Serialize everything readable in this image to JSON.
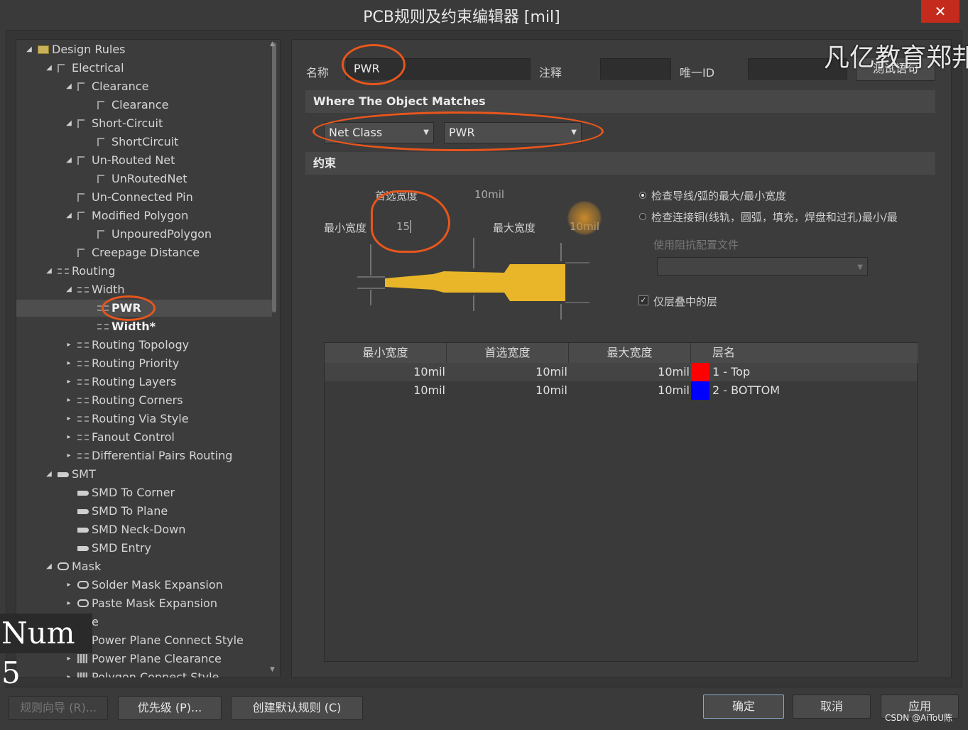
{
  "window": {
    "title": "PCB规则及约束编辑器 [mil]",
    "close_glyph": "✕"
  },
  "tree": {
    "items": [
      {
        "label": "Design Rules",
        "level": 0,
        "expand": "open",
        "icon": "folder-icon"
      },
      {
        "label": "Electrical",
        "level": 1,
        "expand": "open",
        "icon": "rule-icon"
      },
      {
        "label": "Clearance",
        "level": 2,
        "expand": "open",
        "icon": "rule-icon"
      },
      {
        "label": "Clearance",
        "level": 3,
        "expand": "none",
        "icon": "rule-icon"
      },
      {
        "label": "Short-Circuit",
        "level": 2,
        "expand": "open",
        "icon": "rule-icon"
      },
      {
        "label": "ShortCircuit",
        "level": 3,
        "expand": "none",
        "icon": "rule-icon"
      },
      {
        "label": "Un-Routed Net",
        "level": 2,
        "expand": "open",
        "icon": "rule-icon"
      },
      {
        "label": "UnRoutedNet",
        "level": 3,
        "expand": "none",
        "icon": "rule-icon"
      },
      {
        "label": "Un-Connected Pin",
        "level": 2,
        "expand": "none",
        "icon": "rule-icon"
      },
      {
        "label": "Modified Polygon",
        "level": 2,
        "expand": "open",
        "icon": "rule-icon"
      },
      {
        "label": "UnpouredPolygon",
        "level": 3,
        "expand": "none",
        "icon": "rule-icon"
      },
      {
        "label": "Creepage Distance",
        "level": 2,
        "expand": "none",
        "icon": "rule-icon"
      },
      {
        "label": "Routing",
        "level": 1,
        "expand": "open",
        "icon": "routing-icon"
      },
      {
        "label": "Width",
        "level": 2,
        "expand": "open",
        "icon": "routing-icon"
      },
      {
        "label": "PWR",
        "level": 3,
        "expand": "none",
        "icon": "routing-icon",
        "bold": true,
        "selected": true
      },
      {
        "label": "Width*",
        "level": 3,
        "expand": "none",
        "icon": "routing-icon",
        "bold": true
      },
      {
        "label": "Routing Topology",
        "level": 2,
        "expand": "closed",
        "icon": "routing-icon"
      },
      {
        "label": "Routing Priority",
        "level": 2,
        "expand": "closed",
        "icon": "routing-icon"
      },
      {
        "label": "Routing Layers",
        "level": 2,
        "expand": "closed",
        "icon": "routing-icon"
      },
      {
        "label": "Routing Corners",
        "level": 2,
        "expand": "closed",
        "icon": "routing-icon"
      },
      {
        "label": "Routing Via Style",
        "level": 2,
        "expand": "closed",
        "icon": "routing-icon"
      },
      {
        "label": "Fanout Control",
        "level": 2,
        "expand": "closed",
        "icon": "routing-icon"
      },
      {
        "label": "Differential Pairs Routing",
        "level": 2,
        "expand": "closed",
        "icon": "routing-icon"
      },
      {
        "label": "SMT",
        "level": 1,
        "expand": "open",
        "icon": "smt-icon"
      },
      {
        "label": "SMD To Corner",
        "level": 2,
        "expand": "none",
        "icon": "smt-icon"
      },
      {
        "label": "SMD To Plane",
        "level": 2,
        "expand": "none",
        "icon": "smt-icon"
      },
      {
        "label": "SMD Neck-Down",
        "level": 2,
        "expand": "none",
        "icon": "smt-icon"
      },
      {
        "label": "SMD Entry",
        "level": 2,
        "expand": "none",
        "icon": "smt-icon"
      },
      {
        "label": "Mask",
        "level": 1,
        "expand": "open",
        "icon": "mask-icon"
      },
      {
        "label": "Solder Mask Expansion",
        "level": 2,
        "expand": "closed",
        "icon": "mask-icon"
      },
      {
        "label": "Paste Mask Expansion",
        "level": 2,
        "expand": "closed",
        "icon": "mask-icon"
      },
      {
        "label": "e",
        "level": 2,
        "expand": "none",
        "icon": "none"
      },
      {
        "label": "Power Plane Connect Style",
        "level": 2,
        "expand": "none",
        "icon": "plane-icon"
      },
      {
        "label": "Power Plane Clearance",
        "level": 2,
        "expand": "closed",
        "icon": "plane-icon"
      },
      {
        "label": "Polygon Connect Style",
        "level": 2,
        "expand": "closed",
        "icon": "plane-icon"
      }
    ]
  },
  "header": {
    "name_label": "名称",
    "name_value": "PWR",
    "comment_label": "注释",
    "comment_value": "",
    "uid_label": "唯一ID",
    "uid_value": "",
    "test_button": "测试语句"
  },
  "match": {
    "section_title": "Where The Object Matches",
    "type_value": "Net Class",
    "class_value": "PWR"
  },
  "constraints": {
    "section_title": "约束",
    "pref_width_label": "首选宽度",
    "pref_width_value": "10mil",
    "min_width_label": "最小宽度",
    "min_width_value": "15",
    "max_width_label": "最大宽度",
    "max_width_value": "10mil",
    "radio1": "检查导线/弧的最大/最小宽度",
    "radio2": "检查连接铜(线轨，圆弧，填充，焊盘和过孔)最小/最",
    "impedance_label": "使用阻抗配置文件",
    "layer_stack_label": "仅层叠中的层"
  },
  "layer_table": {
    "headers": [
      "最小宽度",
      "首选宽度",
      "最大宽度",
      "层名"
    ],
    "rows": [
      {
        "min": "10mil",
        "pref": "10mil",
        "max": "10mil",
        "color": "#ff0000",
        "layer": "1 - Top"
      },
      {
        "min": "10mil",
        "pref": "10mil",
        "max": "10mil",
        "color": "#0000ff",
        "layer": "2 - BOTTOM"
      }
    ]
  },
  "footer": {
    "wizard": "规则向导 (R)...",
    "priority": "优先级 (P)...",
    "create_default": "创建默认规则 (C)",
    "ok": "确定",
    "cancel": "取消",
    "apply": "应用"
  },
  "overlays": {
    "watermark": "凡亿教育郑邦",
    "num_overlay": "Num 5",
    "csdn": "CSDN @AiToU陈"
  },
  "colors": {
    "annotation_ring": "#e8561c",
    "trace": "#e8b628",
    "close": "#c42b1c"
  }
}
